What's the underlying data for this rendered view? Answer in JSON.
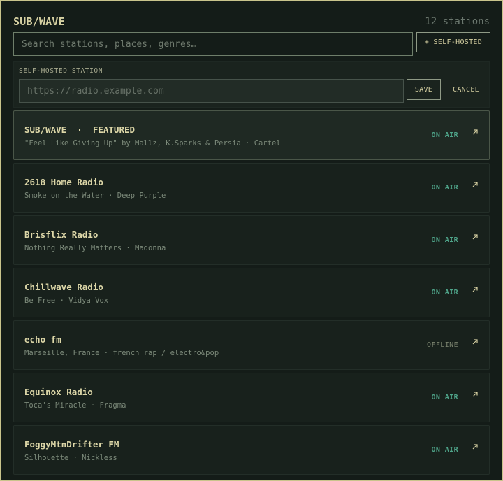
{
  "app": {
    "title": "SUB/WAVE",
    "station_count": "12 stations"
  },
  "search": {
    "placeholder": "Search stations, places, genres…",
    "value": ""
  },
  "selfhost_button": {
    "label": "+ SELF-HOSTED"
  },
  "selfhost_panel": {
    "label": "SELF-HOSTED STATION",
    "url_placeholder": "https://radio.example.com",
    "url_value": "",
    "save_label": "SAVE",
    "cancel_label": "CANCEL"
  },
  "colors": {
    "on_air": "#4fa58a",
    "offline": "#7b846f",
    "accent_text": "#ddd7a8",
    "background": "#141c18"
  },
  "stations": [
    {
      "name": "SUB/WAVE  ·  FEATURED",
      "subtitle": "\"Feel Like Giving Up\" by Mallz, K.Sparks & Persia · Cartel",
      "status": "ON AIR",
      "featured": true,
      "icon": "arrow-up-right-icon"
    },
    {
      "name": "2618 Home Radio",
      "subtitle": "Smoke on the Water · Deep Purple",
      "status": "ON AIR",
      "featured": false,
      "icon": "arrow-up-right-icon"
    },
    {
      "name": "Brisflix Radio",
      "subtitle": "Nothing Really Matters · Madonna",
      "status": "ON AIR",
      "featured": false,
      "icon": "arrow-up-right-icon"
    },
    {
      "name": "Chillwave Radio",
      "subtitle": "Be Free · Vidya Vox",
      "status": "ON AIR",
      "featured": false,
      "icon": "arrow-up-right-icon"
    },
    {
      "name": "echo fm",
      "subtitle": "Marseille, France · french rap / electro&pop",
      "status": "OFFLINE",
      "featured": false,
      "icon": "arrow-up-right-icon"
    },
    {
      "name": "Equinox Radio",
      "subtitle": "Toca's Miracle · Fragma",
      "status": "ON AIR",
      "featured": false,
      "icon": "arrow-up-right-icon"
    },
    {
      "name": "FoggyMtnDrifter FM",
      "subtitle": "Silhouette · Nickless",
      "status": "ON AIR",
      "featured": false,
      "icon": "arrow-up-right-icon"
    }
  ]
}
